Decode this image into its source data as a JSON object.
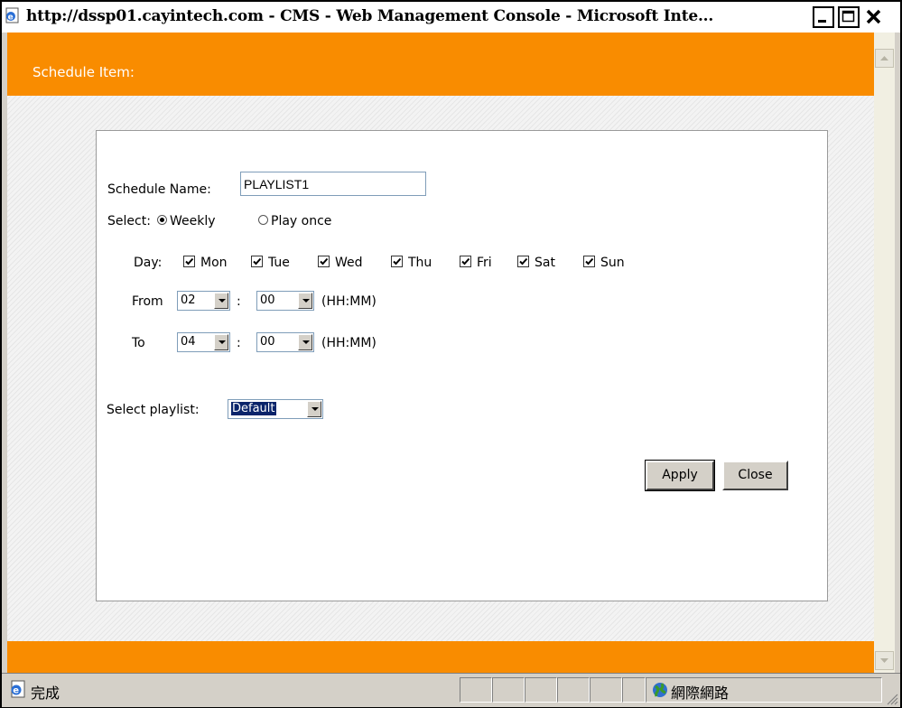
{
  "window": {
    "title": "http://dssp01.cayintech.com - CMS - Web Management Console - Microsoft Inte..."
  },
  "header": {
    "title": "Schedule Item:"
  },
  "form": {
    "schedule_name_label": "Schedule Name:",
    "schedule_name_value": "PLAYLIST1",
    "select_label": "Select:",
    "mode_weekly": "Weekly",
    "mode_once": "Play once",
    "mode_selected": "Weekly",
    "day_label": "Day:",
    "days": [
      "Mon",
      "Tue",
      "Wed",
      "Thu",
      "Fri",
      "Sat",
      "Sun"
    ],
    "days_checked": [
      true,
      true,
      true,
      true,
      true,
      true,
      true
    ],
    "from_label": "From",
    "from_hour": "02",
    "from_minute": "00",
    "to_label": "To",
    "to_hour": "04",
    "to_minute": "00",
    "time_sep": ":",
    "time_format": "(HH:MM)",
    "playlist_label": "Select playlist:",
    "playlist_value": "Default"
  },
  "buttons": {
    "apply": "Apply",
    "close": "Close"
  },
  "statusbar": {
    "status": "完成",
    "zone": "網際網路"
  },
  "colors": {
    "header_orange": "#f98c00",
    "panel_bg": "#ffffff"
  }
}
